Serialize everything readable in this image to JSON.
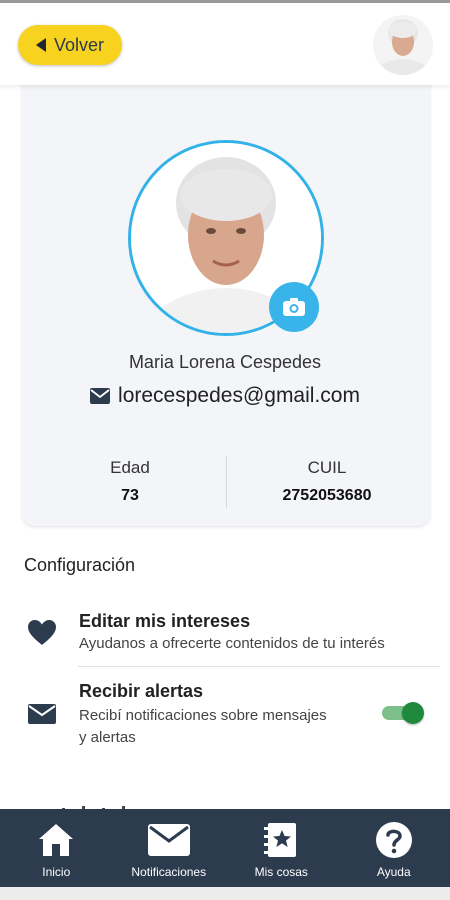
{
  "header": {
    "back_label": "Volver"
  },
  "profile": {
    "name": "Maria Lorena Cespedes",
    "email": "lorecespedes@gmail.com",
    "stats": [
      {
        "label": "Edad",
        "value": "73"
      },
      {
        "label": "CUIL",
        "value": "2752053680"
      }
    ]
  },
  "settings": {
    "title": "Configuración",
    "items": [
      {
        "title": "Editar mis intereses",
        "subtitle": "Ayudanos a ofrecerte contenidos de tu interés",
        "icon": "heart-icon"
      },
      {
        "title": "Recibir alertas",
        "subtitle_line1": "Recibí notificaciones sobre mensajes",
        "subtitle_line2": "y alertas",
        "icon": "envelope-icon",
        "toggle_on": true
      }
    ]
  },
  "nav": {
    "items": [
      {
        "label": "Inicio",
        "icon": "home-icon"
      },
      {
        "label": "Notificaciones",
        "icon": "envelope-icon"
      },
      {
        "label": "Mis cosas",
        "icon": "star-book-icon"
      },
      {
        "label": "Ayuda",
        "icon": "question-icon"
      }
    ]
  },
  "colors": {
    "accent_yellow": "#f7d21e",
    "accent_blue": "#33b2e8",
    "nav_bg": "#2d3b4f",
    "toggle_green": "#1f8a3d"
  }
}
